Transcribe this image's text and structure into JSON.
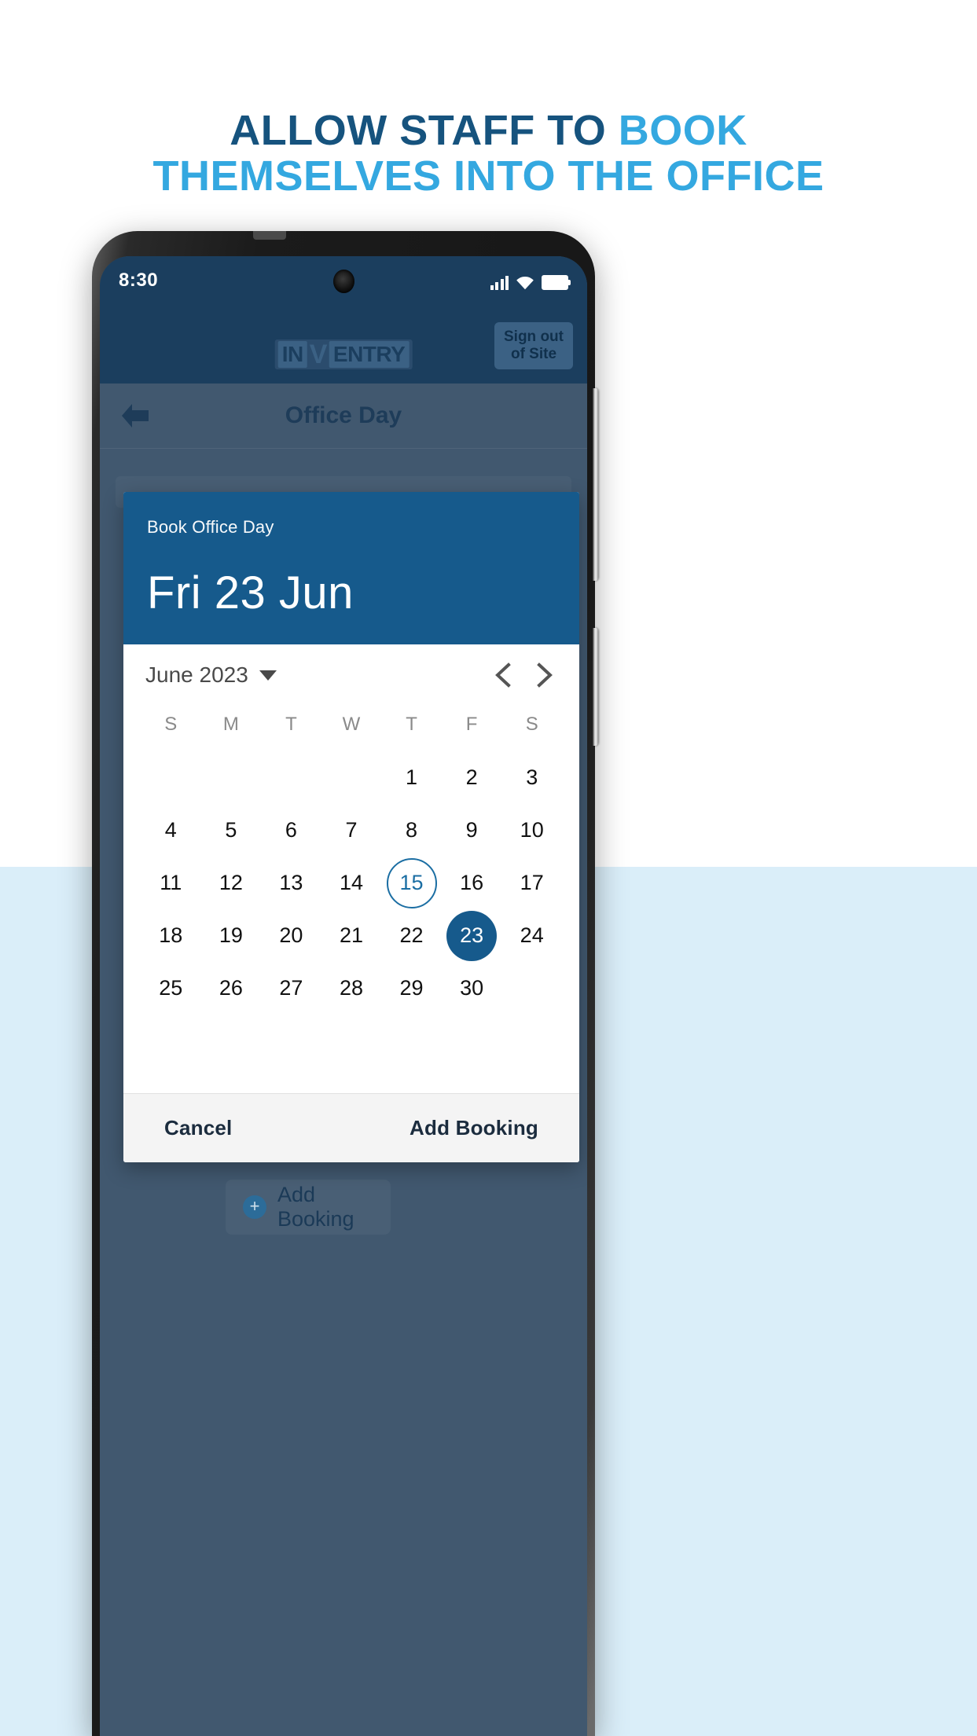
{
  "headline": {
    "line1_dark": "ALLOW STAFF TO ",
    "line1_light": "BOOK",
    "line2_light": "THEMSELVES INTO THE OFFICE",
    "color_dark": "#16537e",
    "color_light": "#34a8e0"
  },
  "phone": {
    "status_bar": {
      "time": "8:30",
      "signal_icon": "signal-bars-icon",
      "wifi_icon": "wifi-icon",
      "battery_icon": "battery-full-icon"
    },
    "app_header": {
      "logo_in": "IN",
      "logo_v": "V",
      "logo_entry": "ENTRY",
      "signout_line1": "Sign out",
      "signout_line2": "of Site"
    },
    "nav_bar": {
      "back_icon": "back-arrow-icon",
      "title": "Office Day"
    },
    "bottom_bar": {
      "add_booking_label": "Add Booking",
      "plus_icon": "plus-circle-icon"
    }
  },
  "modal": {
    "header": {
      "subtitle": "Book Office Day",
      "date": "Fri 23 Jun",
      "bg_color": "#165a8c"
    },
    "calendar": {
      "month_label": "June 2023",
      "dropdown_icon": "chevron-down-icon",
      "prev_icon": "chevron-left-icon",
      "next_icon": "chevron-right-icon",
      "weekdays": [
        "S",
        "M",
        "T",
        "W",
        "T",
        "F",
        "S"
      ],
      "leading_blanks": 4,
      "days": [
        1,
        2,
        3,
        4,
        5,
        6,
        7,
        8,
        9,
        10,
        11,
        12,
        13,
        14,
        15,
        16,
        17,
        18,
        19,
        20,
        21,
        22,
        23,
        24,
        25,
        26,
        27,
        28,
        29,
        30
      ],
      "today": 15,
      "selected": 23,
      "today_color": "#1b6ea3",
      "selected_color": "#165a8c"
    },
    "footer": {
      "cancel_label": "Cancel",
      "confirm_label": "Add Booking"
    }
  }
}
